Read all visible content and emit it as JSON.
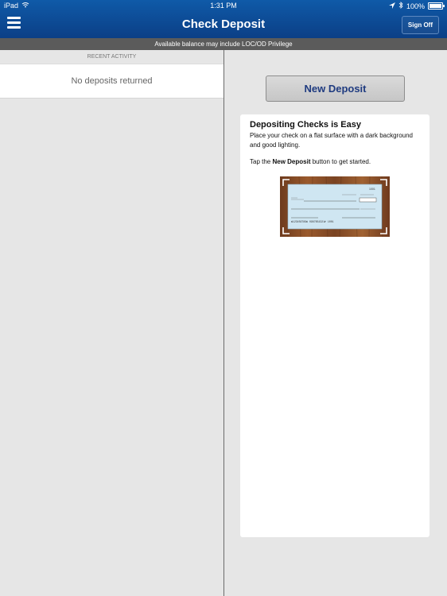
{
  "status_bar": {
    "device": "iPad",
    "time": "1:31 PM",
    "battery": "100%"
  },
  "header": {
    "title": "Check Deposit",
    "sign_off": "Sign Off"
  },
  "banner": {
    "text": "Available balance may include LOC/OD Privilege"
  },
  "left_pane": {
    "section_header": "RECENT ACTIVITY",
    "empty_message": "No deposits returned"
  },
  "right_pane": {
    "new_deposit_label": "New Deposit",
    "info_title": "Depositing Checks is Easy",
    "info_line1": "Place your check on a flat surface with a dark background and good lighting.",
    "info_line2_prefix": "Tap the ",
    "info_line2_bold": "New Deposit",
    "info_line2_suffix": " button to get started.",
    "check_number": "1001",
    "micr_line": "⑆123456789⑆ 0987654321⑈ 1001"
  },
  "colors": {
    "header_blue": "#0b3f86",
    "button_text": "#1f3b80"
  }
}
